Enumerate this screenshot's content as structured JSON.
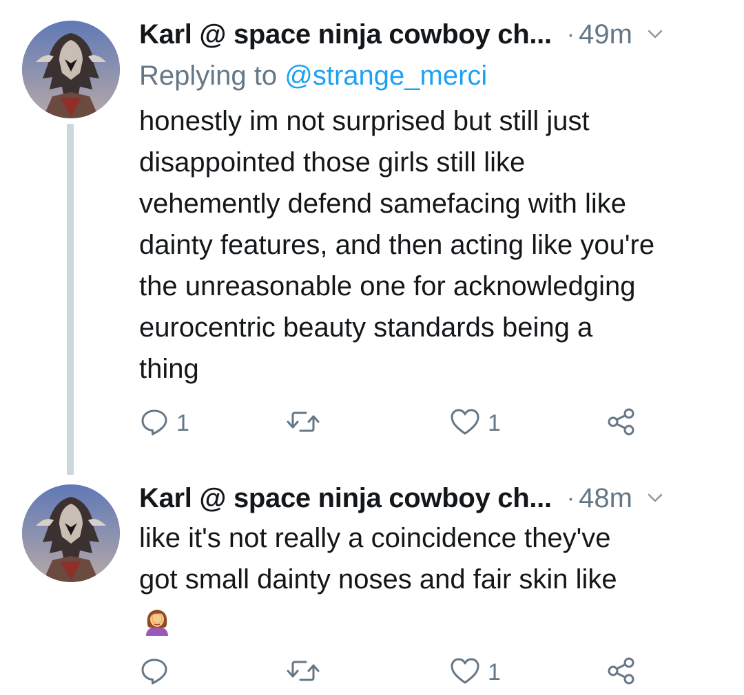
{
  "colors": {
    "text": "#14171a",
    "secondary": "#657786",
    "link": "#1da1f2",
    "thread_line": "#ccd6dd",
    "background": "#ffffff"
  },
  "tweets": [
    {
      "author_name": "Karl @ space ninja cowboy ch...",
      "separator": "·",
      "time": "49m",
      "replying_prefix": "Replying to",
      "replying_handle": "@strange_merci",
      "text": "honestly im not surprised but still just\ndisappointed those girls still like\nvehemently defend samefacing with like\ndainty features, and then acting like you're\nthe unreasonable one for acknowledging\neurocentric beauty standards being a\nthing",
      "reply_count": "1",
      "retweet_count": "",
      "like_count": "1",
      "icons": [
        "reply-icon",
        "retweet-icon",
        "like-icon",
        "share-icon",
        "chevron-down-icon"
      ]
    },
    {
      "author_name": "Karl @ space ninja cowboy ch...",
      "separator": "·",
      "time": "48m",
      "text": "like it's not really a coincidence they've\ngot small dainty noses and fair skin like",
      "emoji": "woman-facepalming",
      "reply_count": "",
      "retweet_count": "",
      "like_count": "1",
      "icons": [
        "reply-icon",
        "retweet-icon",
        "like-icon",
        "share-icon",
        "chevron-down-icon"
      ]
    }
  ]
}
